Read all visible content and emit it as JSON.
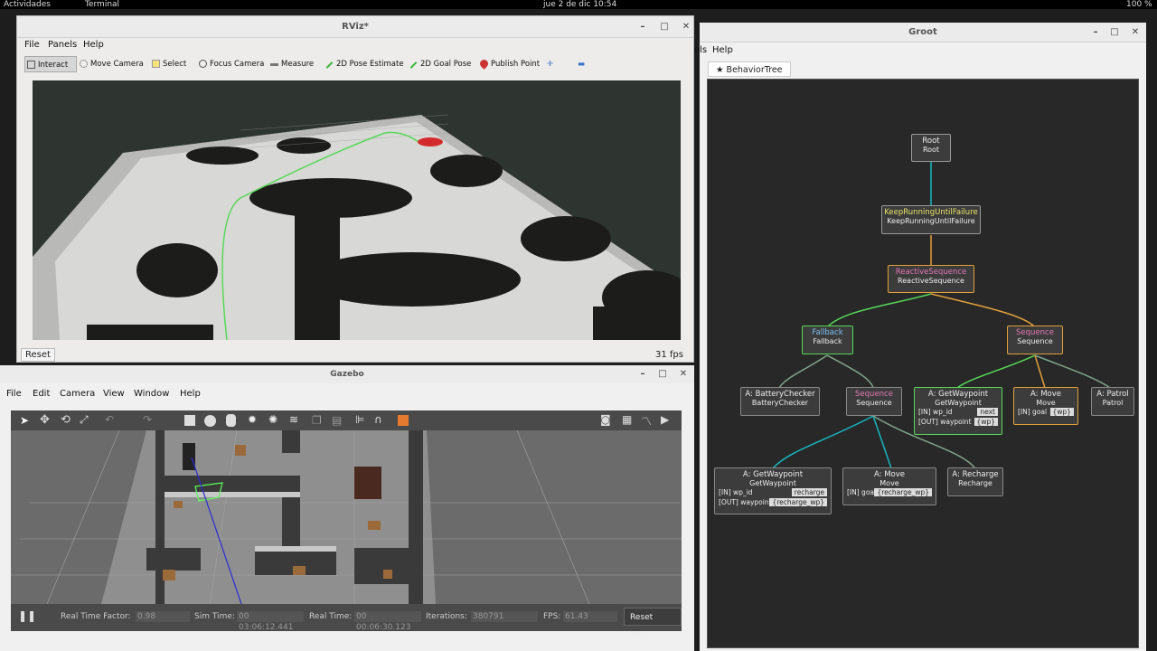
{
  "topbar": {
    "activities": "Actividades",
    "app": "Terminal",
    "clock": "jue 2 de dic  10:54",
    "battery": "100 %"
  },
  "rviz": {
    "title": "RViz*",
    "menu": [
      "File",
      "Panels",
      "Help"
    ],
    "tools": [
      "Interact",
      "Move Camera",
      "Select",
      "Focus Camera",
      "Measure",
      "2D Pose Estimate",
      "2D Goal Pose",
      "Publish Point"
    ],
    "reset": "Reset",
    "fps": "31 fps"
  },
  "gazebo": {
    "title": "Gazebo",
    "menu": [
      "File",
      "Edit",
      "Camera",
      "View",
      "Window",
      "Help"
    ],
    "real_time_factor_label": "Real Time Factor:",
    "real_time_factor": "0.98",
    "sim_time_label": "Sim Time:",
    "sim_time": "00 03:06:12.441",
    "real_time_label": "Real Time:",
    "real_time": "00 00:06:30.123",
    "iterations_label": "Iterations:",
    "iterations": "380791",
    "fps_label": "FPS:",
    "fps": "61.43",
    "reset_time": "Reset Time"
  },
  "groot": {
    "title": "Groot",
    "menu_help": "Help",
    "menu_partial": "ols",
    "tab": "BehaviorTree",
    "nodes": {
      "root": {
        "title": "Root",
        "sub": "Root"
      },
      "krf": {
        "title": "KeepRunningUntilFailure",
        "sub": "KeepRunningUntilFailure"
      },
      "rs": {
        "title": "ReactiveSequence",
        "sub": "ReactiveSequence"
      },
      "fb": {
        "title": "Fallback",
        "sub": "Fallback"
      },
      "seq1": {
        "title": "Sequence",
        "sub": "Sequence"
      },
      "bc": {
        "title": "A: BatteryChecker",
        "sub": "BatteryChecker"
      },
      "seq2": {
        "title": "Sequence",
        "sub": "Sequence"
      },
      "gw1": {
        "title": "A: GetWaypoint",
        "sub": "GetWaypoint",
        "in_label": "[IN] wp_id",
        "in_val": "next",
        "out_label": "[OUT] waypoint",
        "out_val": "{wp}"
      },
      "mv1": {
        "title": "A: Move",
        "sub": "Move",
        "in_label": "[IN] goal",
        "in_val": "{wp}"
      },
      "patrol": {
        "title": "A: Patrol",
        "sub": "Patrol"
      },
      "gw2": {
        "title": "A: GetWaypoint",
        "sub": "GetWaypoint",
        "in_label": "[IN] wp_id",
        "in_val": "recharge",
        "out_label": "[OUT] waypoint",
        "out_val": "{recharge_wp}"
      },
      "mv2": {
        "title": "A:  Move",
        "sub": "Move",
        "in_label": "[IN] goal",
        "in_val": "{recharge_wp}"
      },
      "rc": {
        "title": "A: Recharge",
        "sub": "Recharge"
      }
    }
  }
}
